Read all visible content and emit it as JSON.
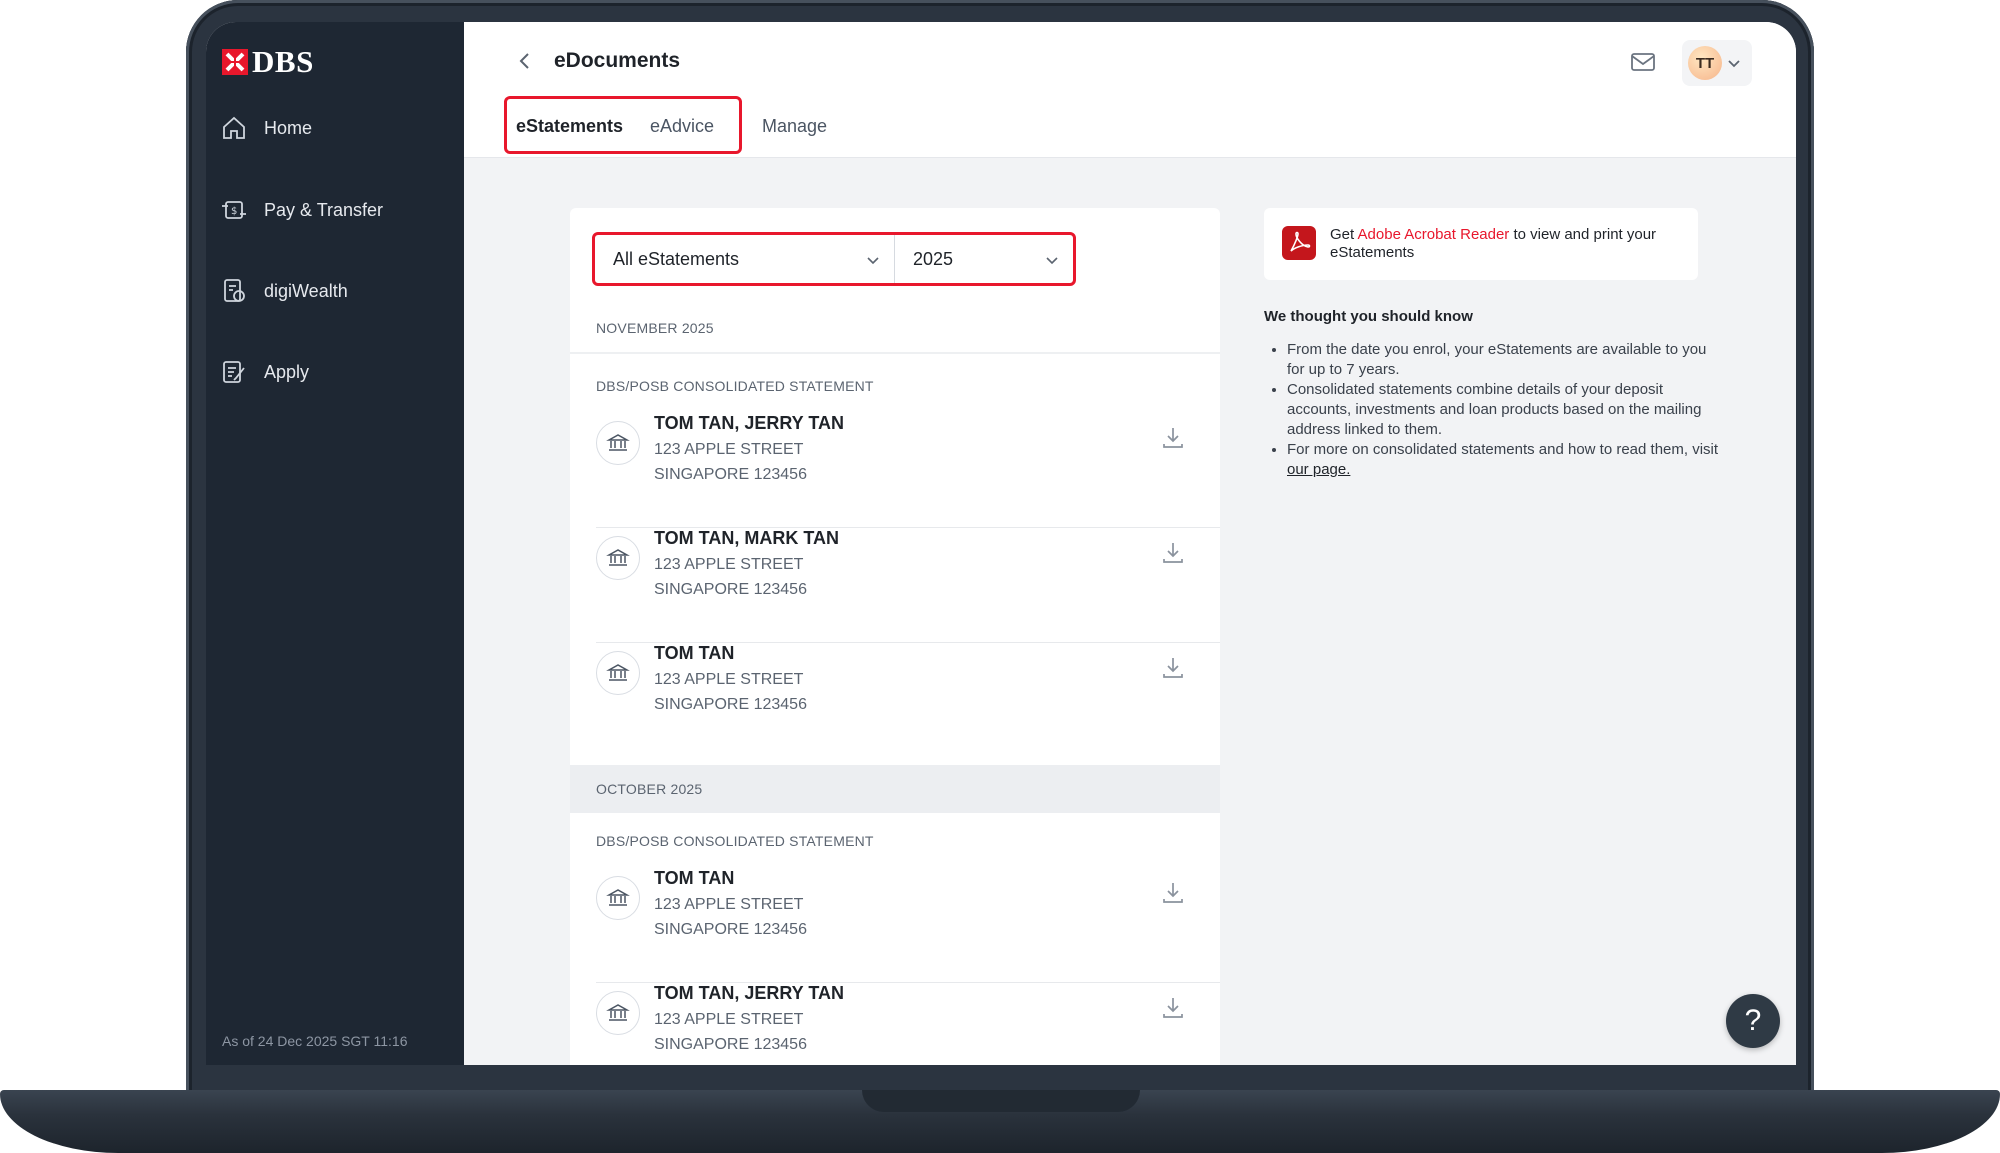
{
  "brand": {
    "name": "DBS",
    "accent": "#e8172c",
    "sidebar_bg": "#1e2733"
  },
  "sidebar": {
    "items": [
      {
        "label": "Home",
        "icon": "home-icon"
      },
      {
        "label": "Pay & Transfer",
        "icon": "pay-transfer-icon"
      },
      {
        "label": "digiWealth",
        "icon": "digiwealth-icon"
      },
      {
        "label": "Apply",
        "icon": "apply-icon"
      }
    ],
    "as_of": "As of 24 Dec 2025 SGT 11:16"
  },
  "header": {
    "title": "eDocuments",
    "avatar_initials": "TT",
    "tabs": [
      {
        "label": "eStatements",
        "active": true
      },
      {
        "label": "eAdvice",
        "active": false
      },
      {
        "label": "Manage",
        "active": false
      }
    ]
  },
  "filters": {
    "type_selected": "All eStatements",
    "year_selected": "2025"
  },
  "statements": {
    "groups": [
      {
        "month": "NOVEMBER 2025",
        "category": "DBS/POSB CONSOLIDATED STATEMENT",
        "items": [
          {
            "name": "TOM TAN, JERRY TAN",
            "line1": "123 APPLE STREET",
            "line2": "SINGAPORE 123456"
          },
          {
            "name": "TOM TAN, MARK TAN",
            "line1": "123 APPLE STREET",
            "line2": "SINGAPORE 123456"
          },
          {
            "name": "TOM TAN",
            "line1": "123 APPLE STREET",
            "line2": "SINGAPORE 123456"
          }
        ]
      },
      {
        "month": "OCTOBER 2025",
        "category": "DBS/POSB CONSOLIDATED STATEMENT",
        "items": [
          {
            "name": "TOM TAN",
            "line1": "123 APPLE STREET",
            "line2": "SINGAPORE 123456"
          },
          {
            "name": "TOM TAN, JERRY TAN",
            "line1": "123 APPLE STREET",
            "line2": "SINGAPORE 123456"
          }
        ]
      }
    ]
  },
  "acrobat": {
    "prefix": "Get ",
    "link": "Adobe Acrobat Reader",
    "suffix": " to view and print your eStatements"
  },
  "info": {
    "title": "We thought you should know",
    "bullets": [
      "From the date you enrol, your eStatements are available to you for up to 7 years.",
      "Consolidated statements combine details of your deposit accounts, investments and loan products based on the mailing address linked to them."
    ],
    "last_bullet_prefix": "For more on consolidated statements and how to read them, visit ",
    "last_bullet_link": "our page."
  },
  "help": {
    "label": "?"
  }
}
